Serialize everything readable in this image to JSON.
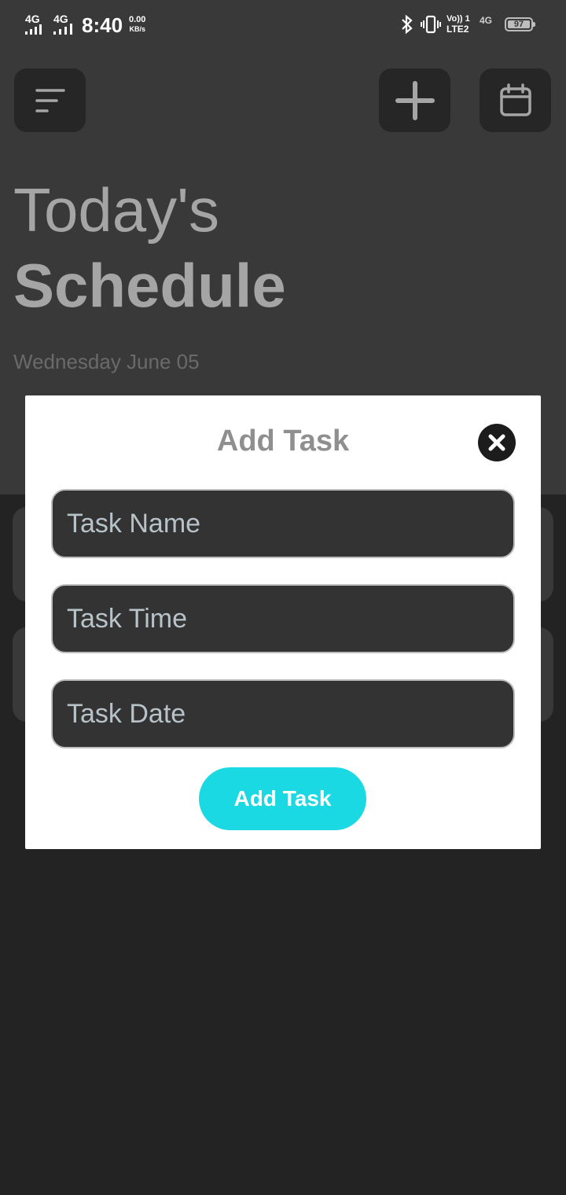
{
  "status_bar": {
    "net1": "4G",
    "net2": "4G",
    "time": "8:40",
    "speed_value": "0.00",
    "speed_unit": "KB/s",
    "volte_top": "Vo)) 1",
    "volte_bottom": "LTE2",
    "net3": "4G",
    "battery": "97"
  },
  "header": {
    "menu_icon": "menu-icon",
    "add_icon": "plus-icon",
    "calendar_icon": "calendar-icon"
  },
  "page": {
    "title_line1": "Today's",
    "title_line2": "Schedule",
    "date": "Wednesday June 05"
  },
  "dialog": {
    "title": "Add Task",
    "close_icon": "close-icon",
    "task_name_placeholder": "Task Name",
    "task_time_placeholder": "Task Time",
    "task_date_placeholder": "Task Date",
    "submit_label": "Add Task"
  },
  "colors": {
    "accent": "#1bd9e2",
    "background": "#232323",
    "header_bg": "#3a393a",
    "dialog_bg": "#ffffff"
  }
}
